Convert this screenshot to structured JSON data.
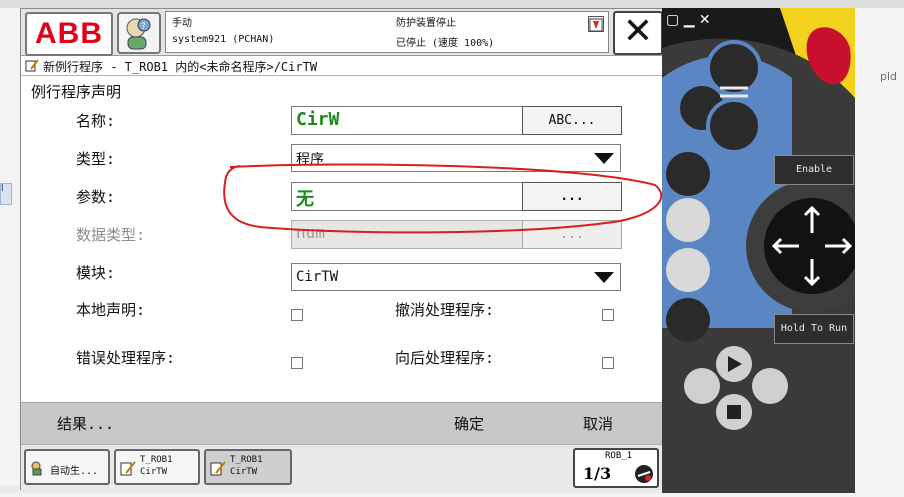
{
  "background": {
    "right_text": "pld",
    "left_tag": "l"
  },
  "topbar": {
    "logo": "ABB",
    "mode": "手动",
    "system": "system921 (PCHAN)",
    "safety": "防护装置停止",
    "state": "已停止 (速度 100%)"
  },
  "title": "新例行程序 - T_ROB1 内的<未命名程序>/CirTW",
  "section_title": "例行程序声明",
  "form": {
    "name": {
      "label": "名称:",
      "value": "CirW",
      "button": "ABC..."
    },
    "type": {
      "label": "类型:",
      "value": "程序"
    },
    "params": {
      "label": "参数:",
      "value": "无",
      "button": "..."
    },
    "datatype": {
      "label": "数据类型:",
      "value": "num",
      "button": "..."
    },
    "module": {
      "label": "模块:",
      "value": "CirTW"
    },
    "local": {
      "label": "本地声明:"
    },
    "undo": {
      "label": "撤消处理程序:"
    },
    "error": {
      "label": "错误处理程序:"
    },
    "backward": {
      "label": "向后处理程序:"
    }
  },
  "bottom": {
    "result": "结果...",
    "ok": "确定",
    "cancel": "取消"
  },
  "taskbar": {
    "auto": "自动生...",
    "t1_line1": "T_ROB1",
    "t1_line2": "CirTW",
    "t2_line1": "T_ROB1",
    "t2_line2": "CirTW",
    "rob": "ROB_1",
    "rob_speed": "1/3"
  },
  "pendant": {
    "enable": "Enable",
    "hold_to_run": "Hold To Run"
  },
  "colors": {
    "abb_red": "#e2001a",
    "value_green": "#1a8a1a",
    "annotation_red": "#d81e1e",
    "pendant_blue": "#5b86c4",
    "pendant_dark": "#3a3a3a",
    "estop_yellow": "#f2d21c"
  }
}
